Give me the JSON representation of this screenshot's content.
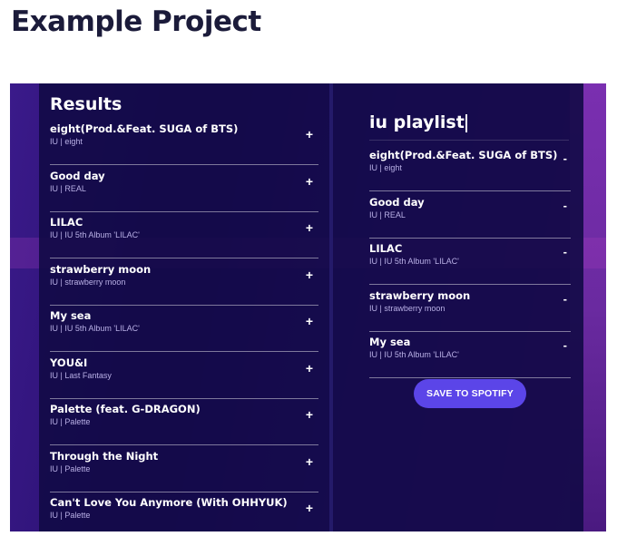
{
  "page": {
    "title": "Example Project"
  },
  "results": {
    "title": "Results",
    "action_symbol": "+",
    "tracks": [
      {
        "name": "eight(Prod.&Feat. SUGA of BTS)",
        "meta": "IU | eight"
      },
      {
        "name": "Good day",
        "meta": "IU | REAL"
      },
      {
        "name": "LILAC",
        "meta": "IU | IU 5th Album 'LILAC'"
      },
      {
        "name": "strawberry moon",
        "meta": "IU | strawberry moon"
      },
      {
        "name": "My sea",
        "meta": "IU | IU 5th Album 'LILAC'"
      },
      {
        "name": "YOU&I",
        "meta": "IU | Last Fantasy"
      },
      {
        "name": "Palette (feat. G-DRAGON)",
        "meta": "IU | Palette"
      },
      {
        "name": "Through the Night",
        "meta": "IU | Palette"
      },
      {
        "name": "Can't Love You Anymore (With OHHYUK)",
        "meta": "IU | Palette"
      }
    ]
  },
  "playlist": {
    "title": "iu playlist",
    "action_symbol": "-",
    "save_label": "SAVE TO SPOTIFY",
    "tracks": [
      {
        "name": "eight(Prod.&Feat. SUGA of BTS)",
        "meta": "IU | eight"
      },
      {
        "name": "Good day",
        "meta": "IU | REAL"
      },
      {
        "name": "LILAC",
        "meta": "IU | IU 5th Album 'LILAC'"
      },
      {
        "name": "strawberry moon",
        "meta": "IU | strawberry moon"
      },
      {
        "name": "My sea",
        "meta": "IU | IU 5th Album 'LILAC'"
      }
    ]
  },
  "colors": {
    "accent": "#5b45e8",
    "panel": "#120a46",
    "background": "#2a1070"
  }
}
